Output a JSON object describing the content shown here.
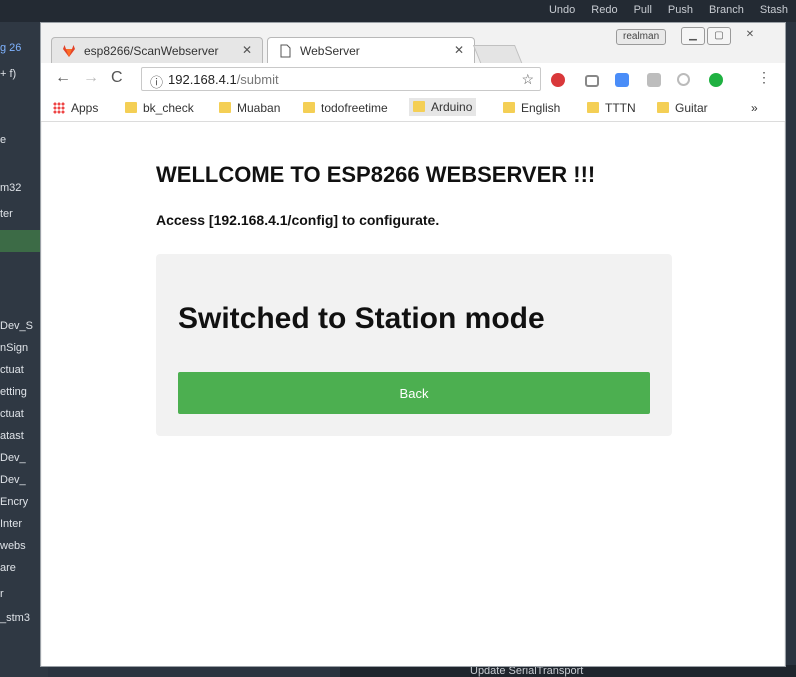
{
  "background_app": {
    "toolbar": [
      "Undo",
      "Redo",
      "Pull",
      "Push",
      "Branch",
      "Stash"
    ],
    "left_items": [
      "g 26",
      "+ f)",
      "e",
      "m32",
      "ter",
      "Dev_S",
      "nSign",
      "ctuat",
      "etting",
      "ctuat",
      "atast",
      "Dev_",
      "Dev_",
      "Encry",
      "Inter",
      "webs",
      "are",
      "r",
      "_stm3"
    ],
    "bottom_text": "Update SerialTransport"
  },
  "browser": {
    "tabs": [
      {
        "label": "esp8266/ScanWebserver",
        "icon": "gitlab-icon"
      },
      {
        "label": "WebServer",
        "icon": "page-icon"
      }
    ],
    "user_badge": "realman",
    "window_controls": [
      "minimize",
      "maximize",
      "close"
    ],
    "url_host": "192.168.4.1",
    "url_path": "/submit",
    "bookmarks": [
      "Apps",
      "bk_check",
      "Muaban",
      "todofreetime",
      "Arduino",
      "English",
      "TTTN",
      "Guitar"
    ],
    "overflow": "»"
  },
  "page": {
    "heading": "WELLCOME TO ESP8266 WEBSERVER !!!",
    "subtitle": "Access [192.168.4.1/config] to configurate.",
    "card_title": "Switched to Station mode",
    "back_label": "Back"
  },
  "colors": {
    "button": "#4caf50",
    "card": "#f2f2f2",
    "folder": "#f4cf55"
  }
}
